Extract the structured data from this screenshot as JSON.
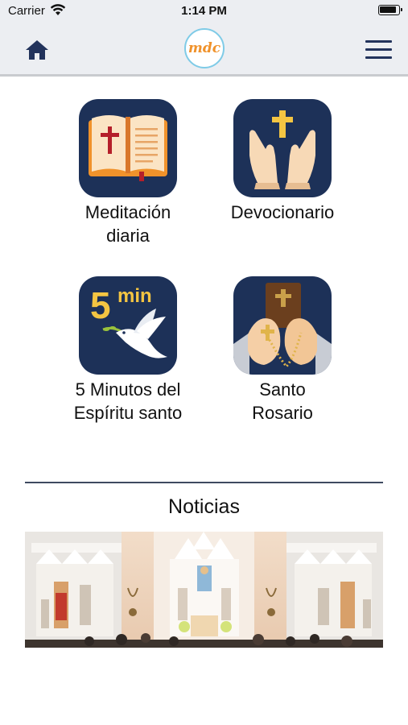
{
  "status_bar": {
    "carrier": "Carrier",
    "time": "1:14 PM"
  },
  "nav": {
    "logo_text": "mdc"
  },
  "tiles": [
    {
      "label": "Meditación\ndiaria",
      "icon": "open-bible-icon"
    },
    {
      "label": "Devocionario",
      "icon": "praying-hands-cross-icon"
    },
    {
      "label": "5 Minutos del\nEspíritu santo",
      "icon": "dove-5min-icon",
      "badge_number": "5",
      "badge_unit": "min"
    },
    {
      "label": "Santo\nRosario",
      "icon": "rosary-hands-icon"
    }
  ],
  "news": {
    "title": "Noticias",
    "image": "church-altar-photo"
  },
  "colors": {
    "tile_bg": "#1d3158",
    "nav_bg": "#eceef2",
    "accent_orange": "#f0922b",
    "gold": "#f4c542"
  }
}
